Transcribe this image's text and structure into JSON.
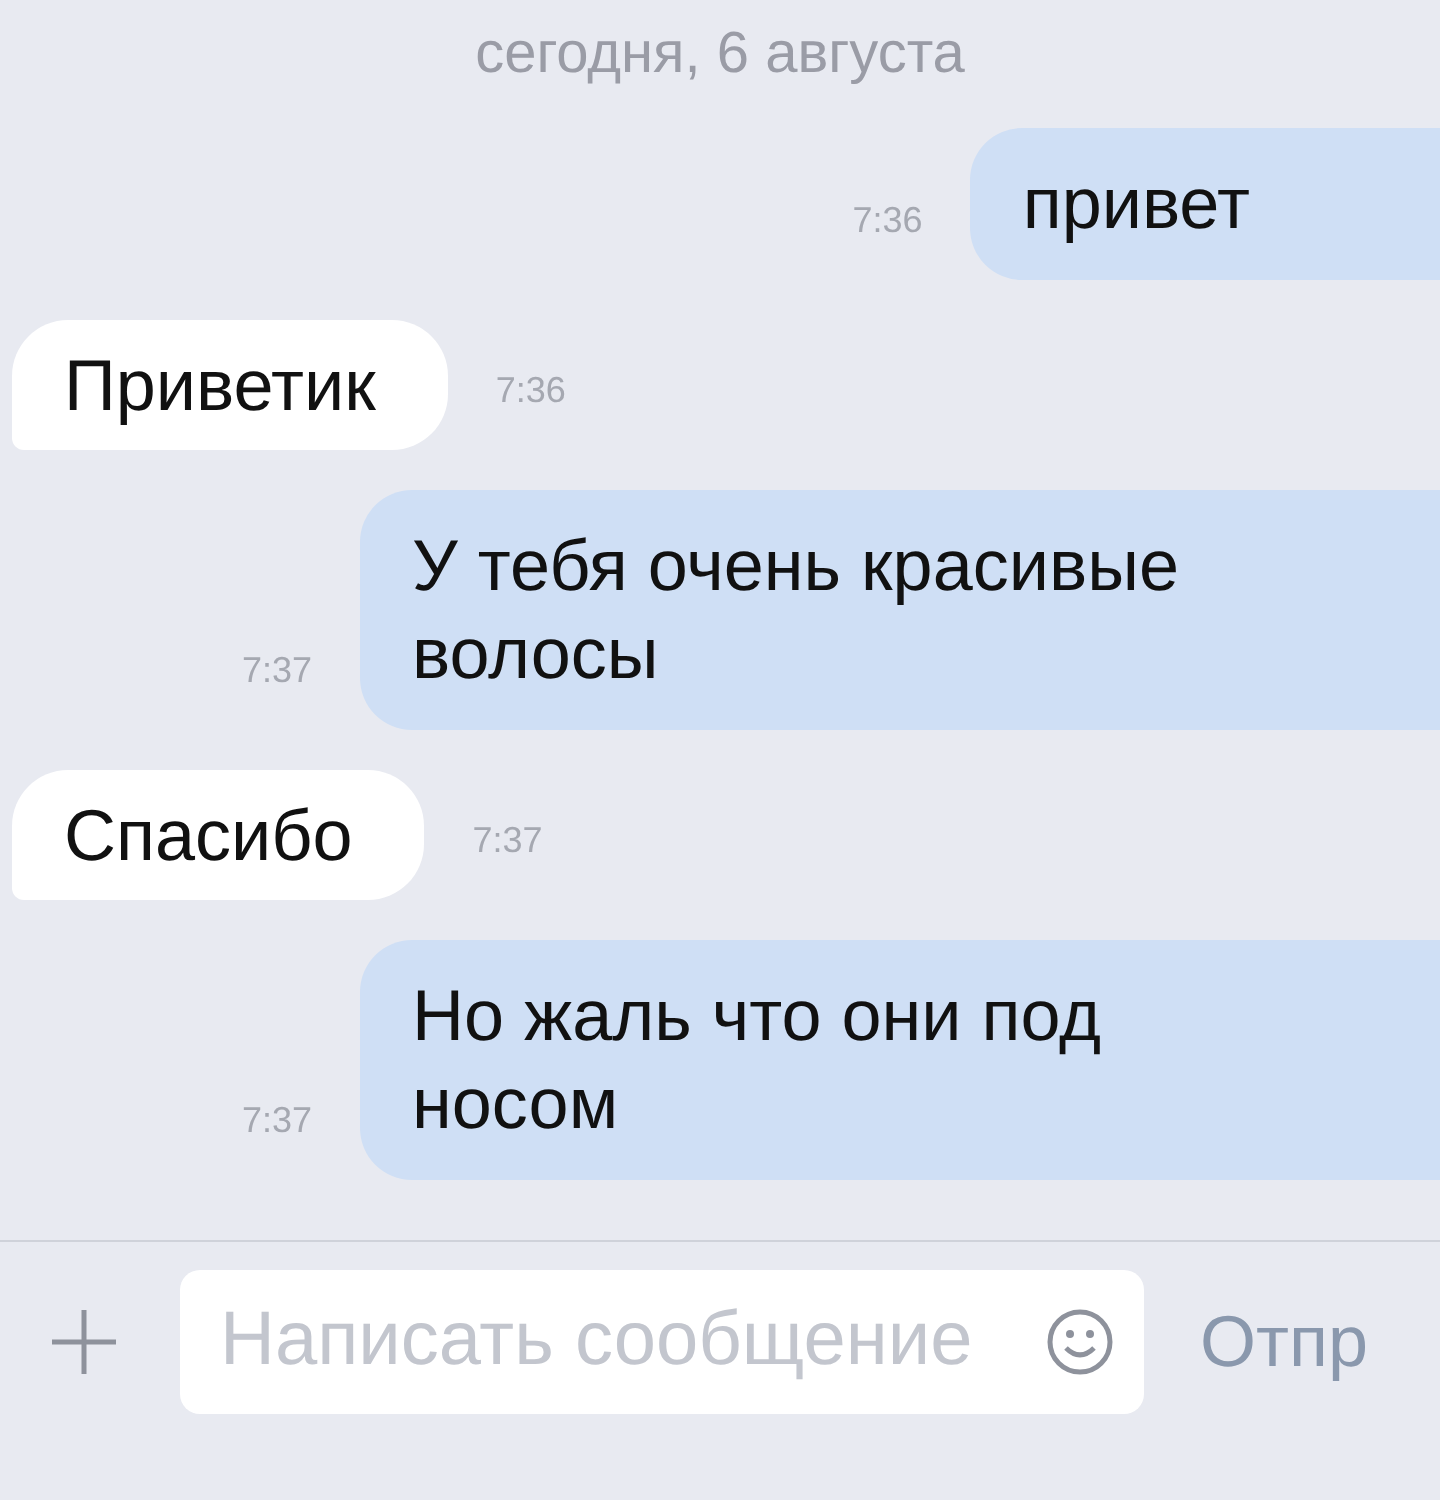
{
  "date_header": "сегодня, 6 августа",
  "messages": [
    {
      "kind": "outgoing",
      "text": "привет",
      "time": "7:36"
    },
    {
      "kind": "incoming",
      "text": "Приветик",
      "time": "7:36"
    },
    {
      "kind": "outgoing",
      "text": "У тебя очень красивые волосы",
      "time": "7:37"
    },
    {
      "kind": "incoming",
      "text": "Спасибо",
      "time": "7:37"
    },
    {
      "kind": "outgoing",
      "text": "Но жаль что они под носом",
      "time": "7:37"
    }
  ],
  "composer": {
    "placeholder": "Написать сообщение",
    "send": "Отпр"
  }
}
